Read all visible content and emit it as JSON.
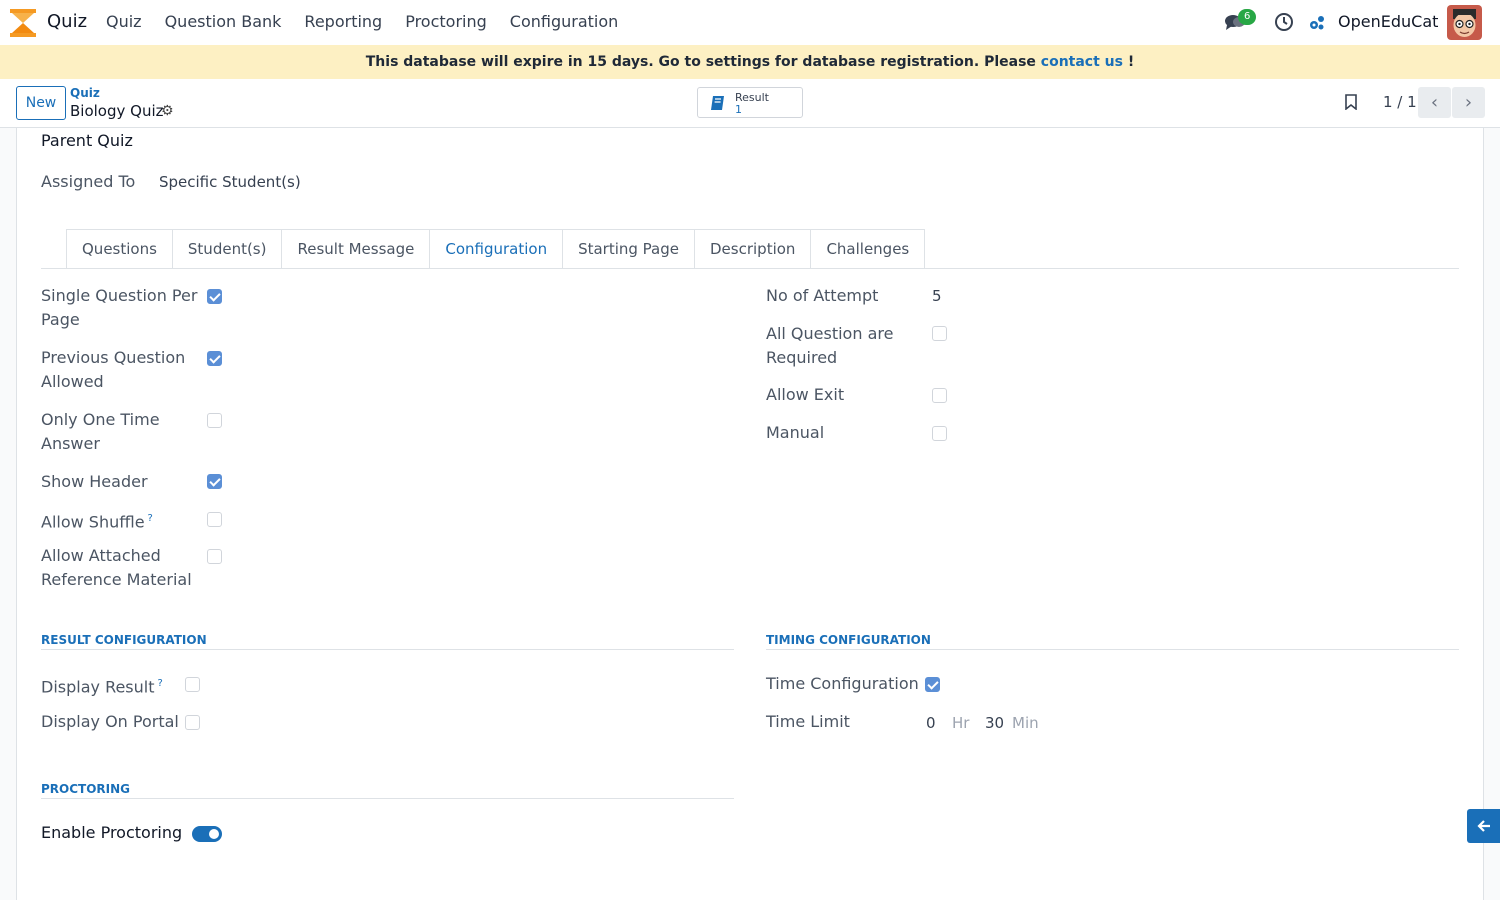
{
  "app": {
    "name": "Quiz",
    "menu": [
      "Quiz",
      "Question Bank",
      "Reporting",
      "Proctoring",
      "Configuration"
    ],
    "chat_count": "6",
    "company": "OpenEduCat"
  },
  "banner": {
    "text": "This database will expire in 15 days. Go to settings for database registration. Please ",
    "link": "contact us",
    "suffix": " !"
  },
  "control_panel": {
    "new_label": "New",
    "breadcrumb_parent": "Quiz",
    "breadcrumb_current": "Biology Quiz",
    "smart_button": {
      "label": "Result",
      "value": "1"
    },
    "pager": "1 / 1"
  },
  "form": {
    "parent_quiz_label": "Parent Quiz",
    "assigned_to_label": "Assigned To",
    "assigned_to_value": "Specific Student(s)",
    "tabs": [
      "Questions",
      "Student(s)",
      "Result Message",
      "Configuration",
      "Starting Page",
      "Description",
      "Challenges"
    ],
    "active_tab": "Configuration",
    "left_fields": [
      {
        "label": "Single Question Per Page",
        "checked": true
      },
      {
        "label": "Previous Question Allowed",
        "checked": true
      },
      {
        "label": "Only One Time Answer",
        "checked": false
      },
      {
        "label": "Show Header",
        "checked": true
      },
      {
        "label": "Allow Shuffle",
        "checked": false,
        "help": "?"
      },
      {
        "label": "Allow Attached Reference Material",
        "checked": false
      }
    ],
    "right_fields": {
      "attempts_label": "No of Attempt",
      "attempts_value": "5",
      "all_required_label": "All Question are Required",
      "all_required": false,
      "allow_exit_label": "Allow Exit",
      "allow_exit": false,
      "manual_label": "Manual",
      "manual": false
    },
    "result_config": {
      "title": "RESULT CONFIGURATION",
      "display_result_label": "Display Result",
      "display_result_help": "?",
      "display_result": false,
      "display_portal_label": "Display On Portal",
      "display_portal": false
    },
    "timing_config": {
      "title": "TIMING CONFIGURATION",
      "time_config_label": "Time Configuration",
      "time_config": true,
      "time_limit_label": "Time Limit",
      "hours": "0",
      "hours_unit": "Hr",
      "minutes": "30",
      "minutes_unit": "Min"
    },
    "proctoring": {
      "title": "PROCTORING",
      "enable_label": "Enable Proctoring",
      "enabled": true
    }
  },
  "colors": {
    "accent": "#1a6fb8",
    "checkbox_on": "#5b8fd6",
    "banner_bg": "#fdf0c3",
    "badge": "#28a745"
  }
}
